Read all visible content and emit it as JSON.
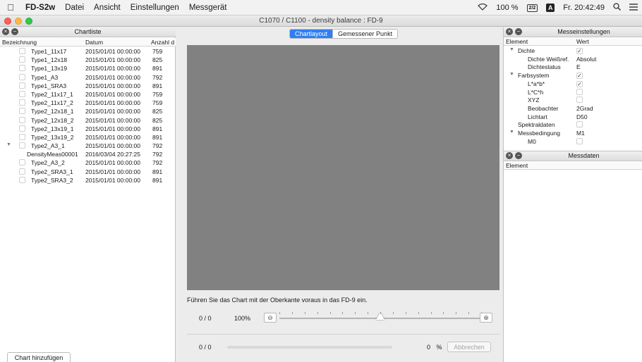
{
  "menubar": {
    "app_name": "FD-S2w",
    "menus": [
      "Datei",
      "Ansicht",
      "Einstellungen",
      "Messgerät"
    ],
    "battery": "100 %",
    "battery_icon": "2/2",
    "input_source": "A",
    "clock": "Fr. 20:42:49"
  },
  "window": {
    "title": "C1070 / C1100 - density balance : FD-9"
  },
  "chartlist": {
    "title": "Chartliste",
    "columns": [
      "Bezeichnung",
      "Datum",
      "Anzahl d"
    ],
    "rows": [
      {
        "name": "Type1_11x17",
        "date": "2015/01/01 00:00:00",
        "count": "759"
      },
      {
        "name": "Type1_12x18",
        "date": "2015/01/01 00:00:00",
        "count": "825"
      },
      {
        "name": "Type1_13x19",
        "date": "2015/01/01 00:00:00",
        "count": "891"
      },
      {
        "name": "Type1_A3",
        "date": "2015/01/01 00:00:00",
        "count": "792"
      },
      {
        "name": "Type1_SRA3",
        "date": "2015/01/01 00:00:00",
        "count": "891"
      },
      {
        "name": "Type2_11x17_1",
        "date": "2015/01/01 00:00:00",
        "count": "759"
      },
      {
        "name": "Type2_11x17_2",
        "date": "2015/01/01 00:00:00",
        "count": "759"
      },
      {
        "name": "Type2_12x18_1",
        "date": "2015/01/01 00:00:00",
        "count": "825"
      },
      {
        "name": "Type2_12x18_2",
        "date": "2015/01/01 00:00:00",
        "count": "825"
      },
      {
        "name": "Type2_13x19_1",
        "date": "2015/01/01 00:00:00",
        "count": "891"
      },
      {
        "name": "Type2_13x19_2",
        "date": "2015/01/01 00:00:00",
        "count": "891"
      },
      {
        "name": "Type2_A3_1",
        "date": "2015/01/01 00:00:00",
        "count": "792"
      },
      {
        "name": "DensityMeas00001",
        "date": "2016/03/04 20:27:25",
        "count": "792"
      },
      {
        "name": "Type2_A3_2",
        "date": "2015/01/01 00:00:00",
        "count": "792"
      },
      {
        "name": "Type2_SRA3_1",
        "date": "2015/01/01 00:00:00",
        "count": "891"
      },
      {
        "name": "Type2_SRA3_2",
        "date": "2015/01/01 00:00:00",
        "count": "891"
      }
    ],
    "add_button": "Chart hinzufügen"
  },
  "center": {
    "tabs": [
      "Chartlayout",
      "Gemessener Punkt"
    ],
    "active_tab": "Chartlayout",
    "hint": "Führen Sie das Chart mit der Oberkante voraus in das FD-9 ein.",
    "page_counter": "0 / 0",
    "zoom": "100%",
    "zoom_level_fraction": 0.5,
    "progress_counter": "0 / 0",
    "progress_percent": "0",
    "progress_unit": "%",
    "cancel_button": "Abbrechen"
  },
  "messeinstellungen": {
    "title": "Messeinstellungen",
    "columns": [
      "Element",
      "Wert"
    ],
    "rows": [
      {
        "label": "Dichte",
        "value": "✓",
        "expanded": true,
        "level": 0
      },
      {
        "label": "Dichte Weißref.",
        "value": "Absolut",
        "level": 1
      },
      {
        "label": "Dichtestatus",
        "value": "E",
        "level": 1
      },
      {
        "label": "Farbsystem",
        "value": "✓",
        "expanded": true,
        "level": 0
      },
      {
        "label": "L*a*b*",
        "value": "✓",
        "level": 1
      },
      {
        "label": "L*C*h",
        "value": "",
        "level": 1
      },
      {
        "label": "XYZ",
        "value": "",
        "level": 1
      },
      {
        "label": "Beobachter",
        "value": "2Grad",
        "level": 1
      },
      {
        "label": "Lichtart",
        "value": "D50",
        "level": 1
      },
      {
        "label": "Spektraldaten",
        "value": "",
        "level": 0
      },
      {
        "label": "Messbedingung",
        "value": "M1",
        "expanded": true,
        "level": 0
      },
      {
        "label": "M0",
        "value": "",
        "level": 1
      }
    ]
  },
  "messdaten": {
    "title": "Messdaten",
    "columns": [
      "Element"
    ]
  }
}
